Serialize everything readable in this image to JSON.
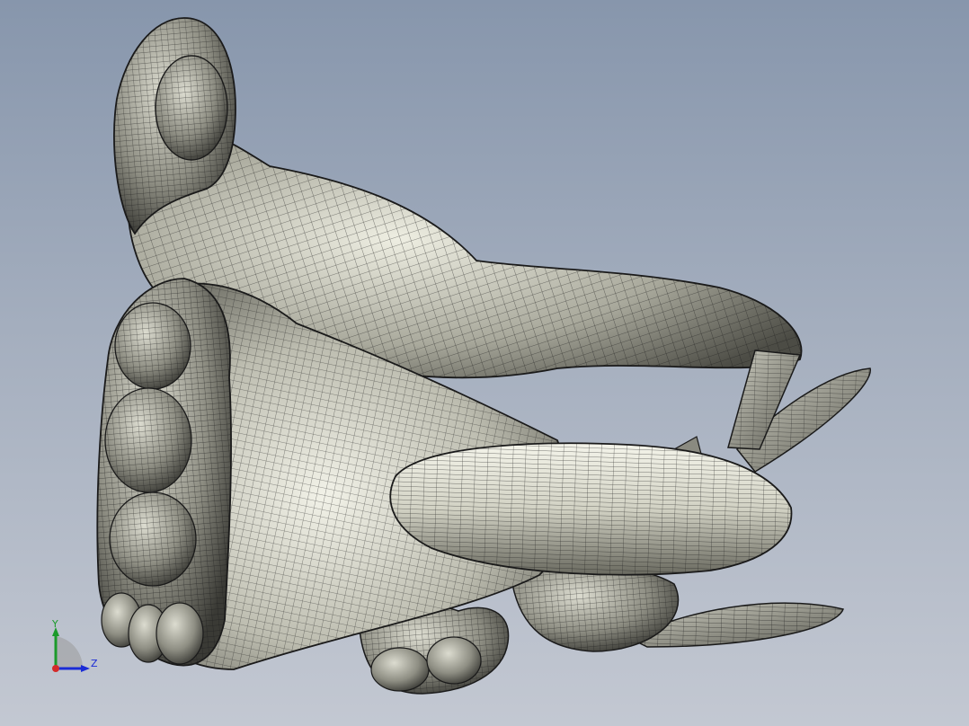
{
  "viewport": {
    "background_top": "#8796ac",
    "background_bottom": "#c3c8d2"
  },
  "model": {
    "surface_color": "#d9d9cc",
    "mesh_color": "#1a1a1a"
  },
  "triad": {
    "y_label": "Y",
    "z_label": "Z",
    "y_color": "#1b9a2a",
    "z_color": "#1a2bd6",
    "x_color": "#d42a2a"
  }
}
